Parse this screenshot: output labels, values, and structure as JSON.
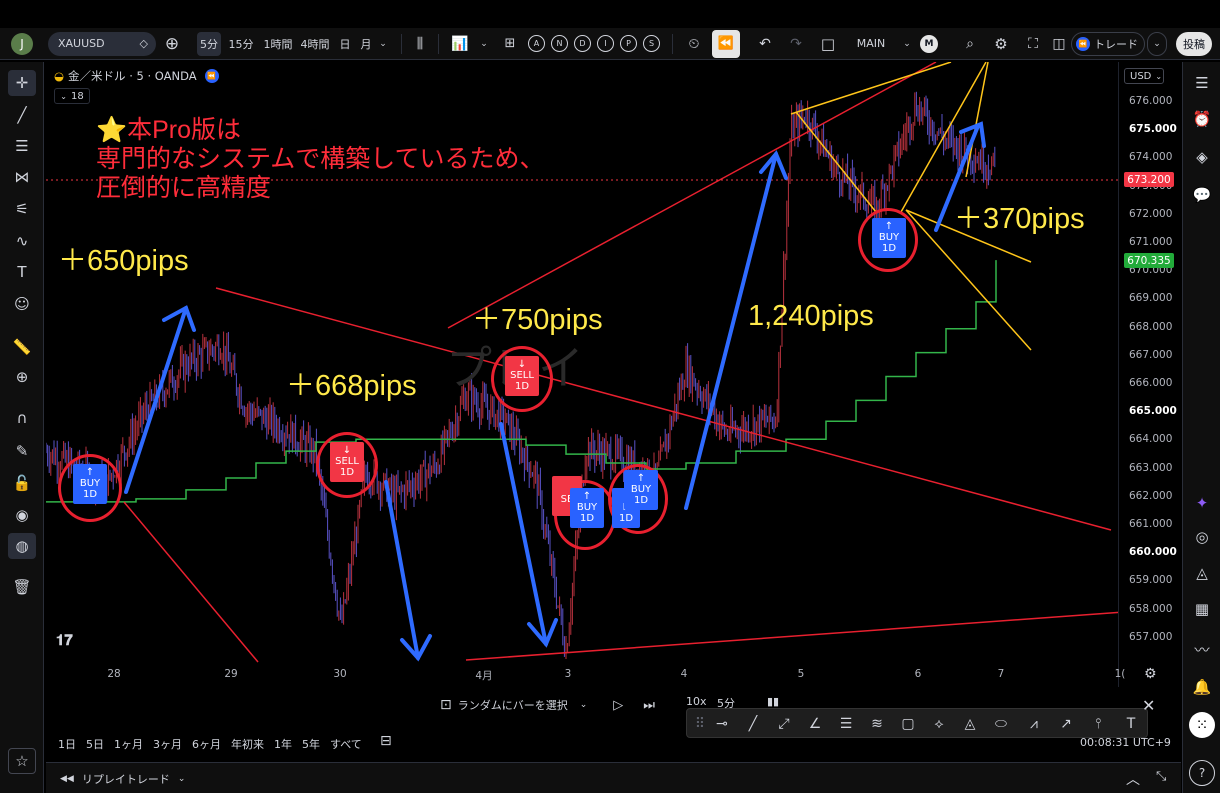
{
  "topbar": {
    "avatar_letter": "J",
    "symbol": "XAUUSD",
    "intervals": [
      "5分",
      "15分",
      "1時間",
      "4時間",
      "日",
      "月"
    ],
    "indicator_letters": [
      "A",
      "N",
      "D",
      "I",
      "P",
      "S"
    ],
    "layout_name": "MAIN",
    "layout_badge": "M",
    "trade_label": "トレード",
    "publish_label": "投稿"
  },
  "legend": {
    "title": "金／米ドル · 5 · OANDA",
    "collapse_count": "18"
  },
  "watermark": "プレイ",
  "annotations": {
    "promo_line1": "⭐本Pro版は",
    "promo_line2": "専門的なシステムで構築しているため、",
    "promo_line3": "圧倒的に高精度",
    "pips": [
      "＋650pips",
      "＋668pips",
      "＋750pips",
      "1,240pips",
      "＋370pips"
    ]
  },
  "signals": {
    "buy_arrow": "↑",
    "sell_arrow": "↓",
    "buy": "BUY",
    "sell": "SELL",
    "period": "1D",
    "partial_sell": "SE",
    "partial_buy": "B"
  },
  "price_axis": {
    "currency": "USD",
    "ticks": [
      "676.000",
      "675.000",
      "674.000",
      "673.000",
      "672.000",
      "671.000",
      "670.000",
      "669.000",
      "668.000",
      "667.000",
      "666.000",
      "665.000",
      "664.000",
      "663.000",
      "662.000",
      "661.000",
      "660.000",
      "659.000",
      "658.000",
      "657.000"
    ],
    "current_price": "673.200",
    "indicator_price": "670.335",
    "current_color": "#f23645",
    "indicator_color": "#22ab3a"
  },
  "time_axis": {
    "ticks": [
      "28",
      "29",
      "30",
      "4月",
      "3",
      "4",
      "5",
      "6",
      "7",
      "1("
    ]
  },
  "replay_bar": {
    "select_label": "ランダムにバーを選択",
    "speed": "10x",
    "interval": "5分"
  },
  "range_bar": {
    "ranges": [
      "1日",
      "5日",
      "1ヶ月",
      "3ヶ月",
      "6ヶ月",
      "年初来",
      "1年",
      "5年",
      "すべて"
    ],
    "clock": "00:08:31 UTC+9"
  },
  "status": {
    "replay_trade": "リプレイトレード"
  },
  "chart_data": {
    "type": "line",
    "instrument": "金／米ドル",
    "interval": "5",
    "broker": "OANDA",
    "y_range": [
      656.5,
      676.6
    ],
    "x_dates": [
      "28",
      "29",
      "30",
      "4月",
      "3",
      "4",
      "5",
      "6",
      "7"
    ],
    "last_price": 673.2,
    "indicator_last": 670.335,
    "signals": [
      {
        "type": "BUY",
        "period": "1D",
        "x": "28",
        "price": 662.2
      },
      {
        "type": "SELL",
        "period": "1D",
        "x": "30",
        "price": 663.2
      },
      {
        "type": "SELL",
        "period": "1D",
        "x": "4月",
        "price": 666.1
      },
      {
        "type": "SELL",
        "period": "1D",
        "x": "3",
        "price": 661.8
      },
      {
        "type": "BUY",
        "period": "1D",
        "x": "3",
        "price": 661.2
      },
      {
        "type": "BUY",
        "period": "1D",
        "x": "4",
        "price": 661.9
      },
      {
        "type": "BUY",
        "period": "1D",
        "x": "6",
        "price": 671.2
      }
    ]
  }
}
